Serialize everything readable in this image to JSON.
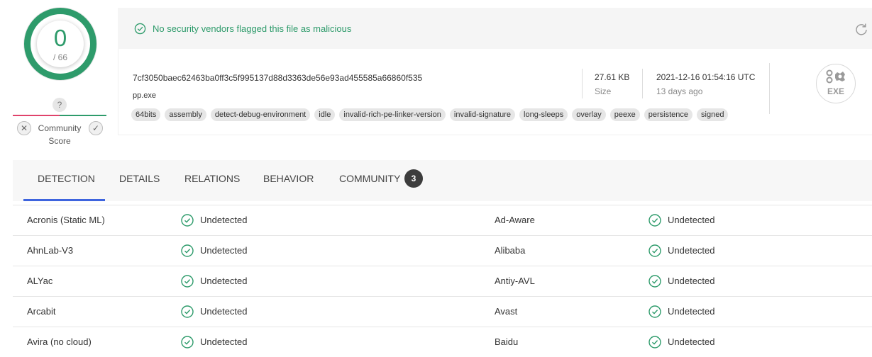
{
  "score": {
    "positives": "0",
    "total": "/ 66",
    "community_question": "?",
    "community_label_1": "Community",
    "community_label_2": "Score",
    "vote_down": "✕",
    "vote_up": "✓"
  },
  "banner": {
    "message": "No security vendors flagged this file as malicious",
    "status_color": "#2e9b6b"
  },
  "file": {
    "hash": "7cf3050baec62463ba0ff3c5f995137d88d3363de56e93ad455585a66860f535",
    "name": "pp.exe",
    "tags": [
      "64bits",
      "assembly",
      "detect-debug-environment",
      "idle",
      "invalid-rich-pe-linker-version",
      "invalid-signature",
      "long-sleeps",
      "overlay",
      "peexe",
      "persistence",
      "signed"
    ],
    "size_value": "27.61 KB",
    "size_label": "Size",
    "date_value": "2021-12-16 01:54:16 UTC",
    "date_label": "13 days ago",
    "type_label": "EXE"
  },
  "tabs": {
    "detection": "DETECTION",
    "details": "DETAILS",
    "relations": "RELATIONS",
    "behavior": "BEHAVIOR",
    "community": "COMMUNITY",
    "community_count": "3",
    "active_color": "#3e64de"
  },
  "results": [
    {
      "left_vendor": "Acronis (Static ML)",
      "left_result": "Undetected",
      "right_vendor": "Ad-Aware",
      "right_result": "Undetected"
    },
    {
      "left_vendor": "AhnLab-V3",
      "left_result": "Undetected",
      "right_vendor": "Alibaba",
      "right_result": "Undetected"
    },
    {
      "left_vendor": "ALYac",
      "left_result": "Undetected",
      "right_vendor": "Antiy-AVL",
      "right_result": "Undetected"
    },
    {
      "left_vendor": "Arcabit",
      "left_result": "Undetected",
      "right_vendor": "Avast",
      "right_result": "Undetected"
    },
    {
      "left_vendor": "Avira (no cloud)",
      "left_result": "Undetected",
      "right_vendor": "Baidu",
      "right_result": "Undetected"
    }
  ]
}
